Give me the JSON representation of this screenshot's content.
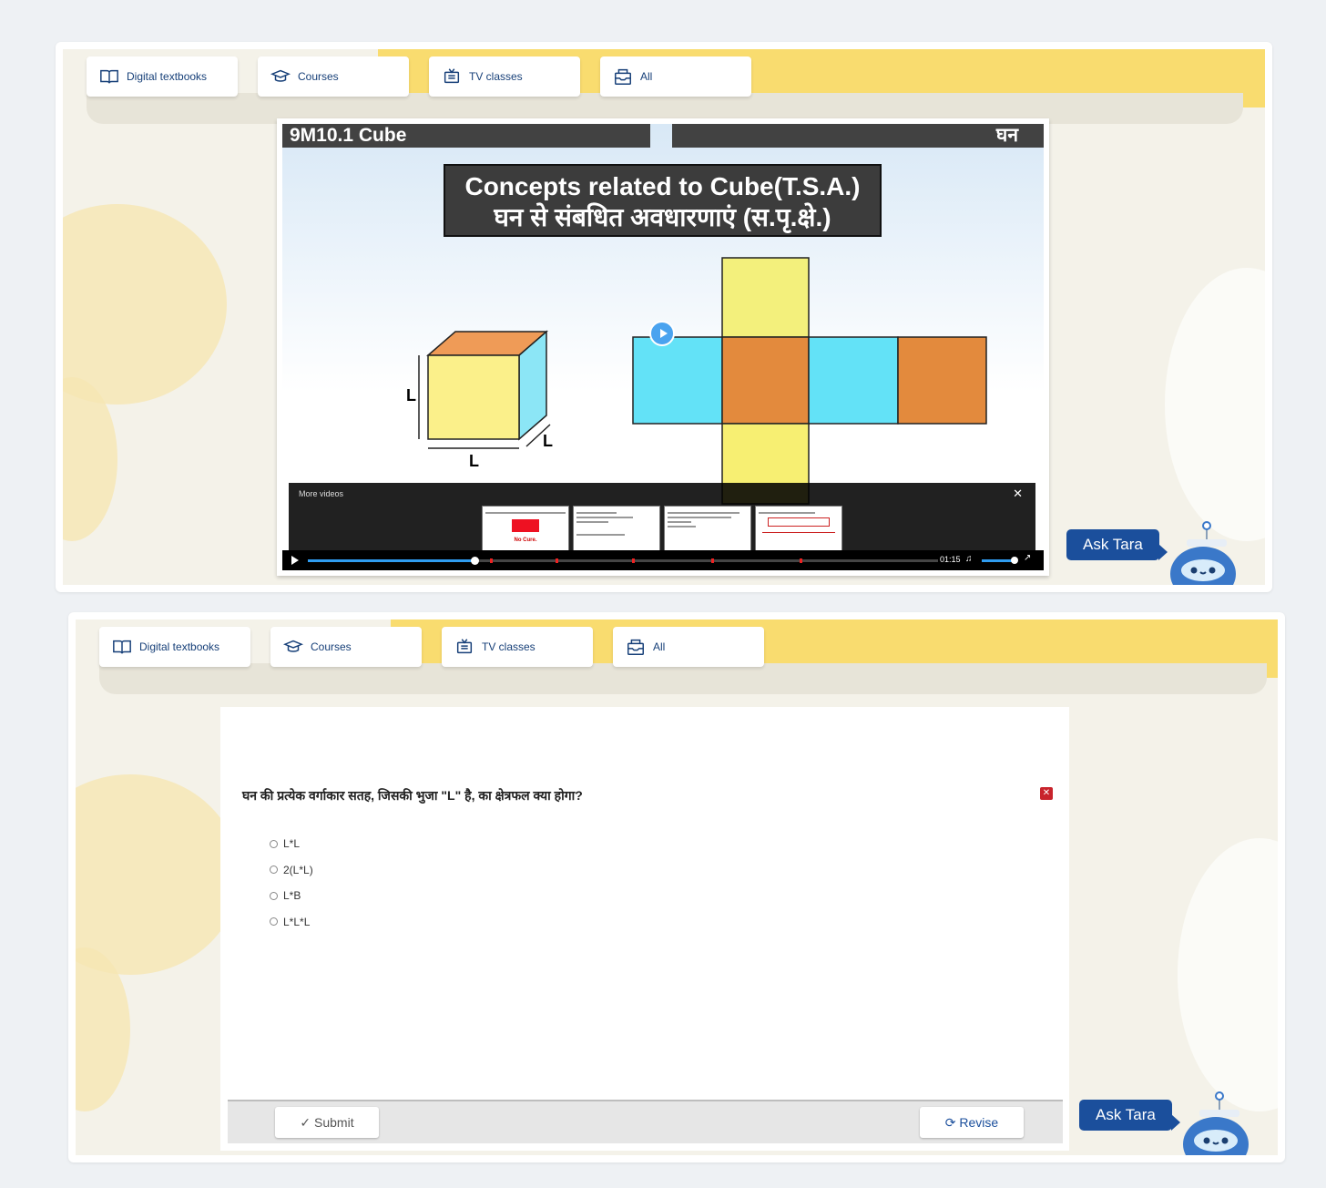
{
  "tabs": [
    {
      "icon": "book-icon",
      "label": "Digital textbooks"
    },
    {
      "icon": "graduation-cap-icon",
      "label": "Courses"
    },
    {
      "icon": "tv-icon",
      "label": "TV classes"
    },
    {
      "icon": "inbox-icon",
      "label": "All"
    }
  ],
  "video": {
    "title": "9M10.1  Cube",
    "corner_label": "घन",
    "heading_en": "Concepts related to Cube(T.S.A.)",
    "heading_hi": "घन से संबधित अवधारणाएं (स.पृ.क्षे.)",
    "dim_label": "L",
    "more_videos_label": "More videos",
    "close_symbol": "✕",
    "time": "01:15",
    "progress_fraction": 0.265,
    "thumb_caption": "No Cure."
  },
  "assistant": {
    "label": "Ask Tara"
  },
  "quiz": {
    "question": "घन की प्रत्येक वर्गाकार सतह, जिसकी भुजा \"L\" है, का क्षेत्रफल क्या होगा?",
    "options": [
      "L*L",
      "2(L*L)",
      "L*B",
      "L*L*L"
    ],
    "submit_label": "✓ Submit",
    "revise_label": "Revise",
    "revise_icon": "refresh-icon"
  },
  "colors": {
    "brand": "#1b4f9c",
    "accent_yellow": "#f9dc6f",
    "close_red": "#c8232c"
  }
}
